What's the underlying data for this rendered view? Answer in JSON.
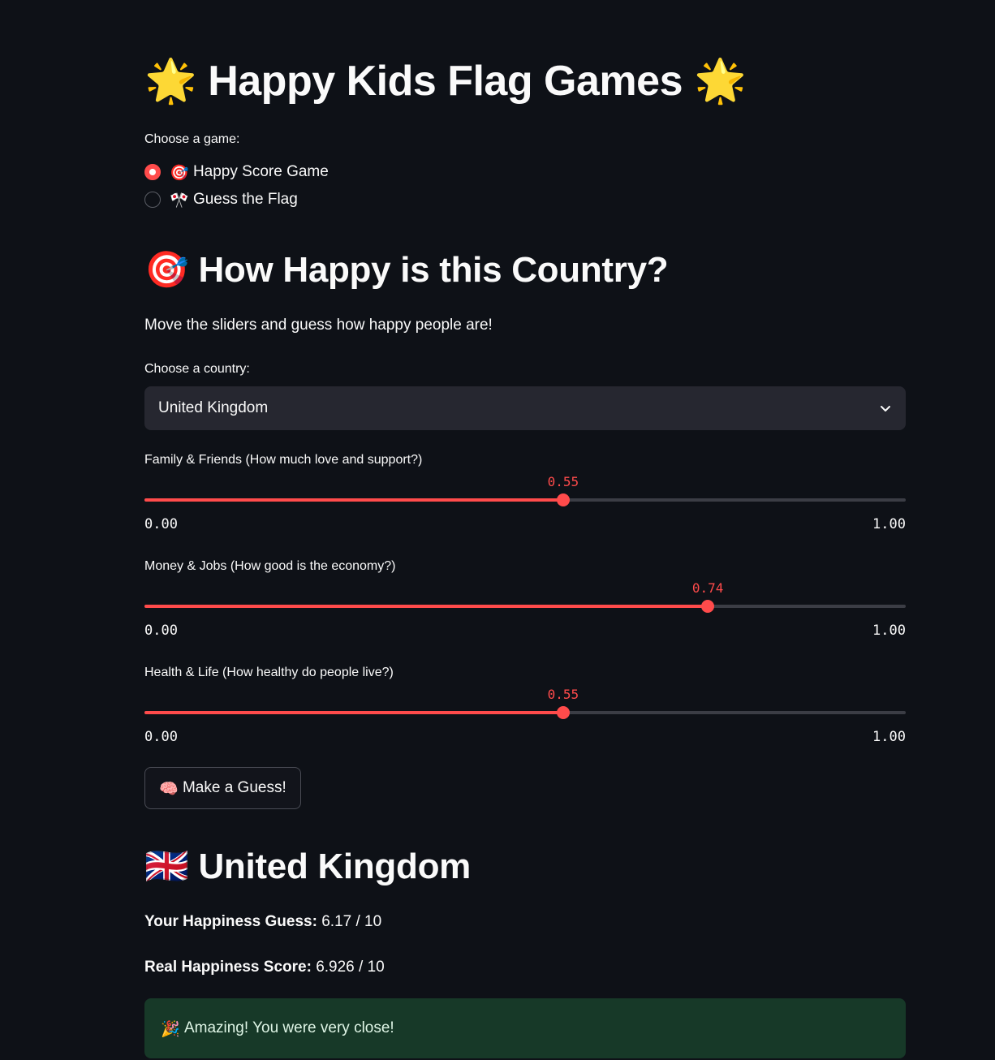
{
  "app": {
    "title_icon": "🌟",
    "title": "Happy Kids Flag Games",
    "title_icon_right": "🌟"
  },
  "game_choice": {
    "label": "Choose a game:",
    "options": [
      {
        "icon": "🎯",
        "label": "Happy Score Game",
        "selected": true
      },
      {
        "icon": "🎌",
        "label": "Guess the Flag",
        "selected": false
      }
    ]
  },
  "section": {
    "icon": "🎯",
    "title": "How Happy is this Country?",
    "subtitle": "Move the sliders and guess how happy people are!"
  },
  "country_select": {
    "label": "Choose a country:",
    "value": "United Kingdom",
    "icon": "chevron-down-icon"
  },
  "sliders": [
    {
      "label": "Family & Friends (How much love and support?)",
      "value": 0.55,
      "value_text": "0.55",
      "min_text": "0.00",
      "max_text": "1.00"
    },
    {
      "label": "Money & Jobs (How good is the economy?)",
      "value": 0.74,
      "value_text": "0.74",
      "min_text": "0.00",
      "max_text": "1.00"
    },
    {
      "label": "Health & Life (How healthy do people live?)",
      "value": 0.55,
      "value_text": "0.55",
      "min_text": "0.00",
      "max_text": "1.00"
    }
  ],
  "guess_button": {
    "icon": "🧠",
    "label": "Make a Guess!"
  },
  "result": {
    "flag_icon": "🇬🇧",
    "country": "United Kingdom",
    "guess_label": "Your Happiness Guess:",
    "guess_value": "6.17 / 10",
    "real_label": "Real Happiness Score:",
    "real_value": "6.926 / 10",
    "message_icon": "🎉",
    "message": "Amazing! You were very close!"
  },
  "colors": {
    "background": "#0e1117",
    "accent": "#ff4b4b",
    "success_bg": "#173928"
  }
}
